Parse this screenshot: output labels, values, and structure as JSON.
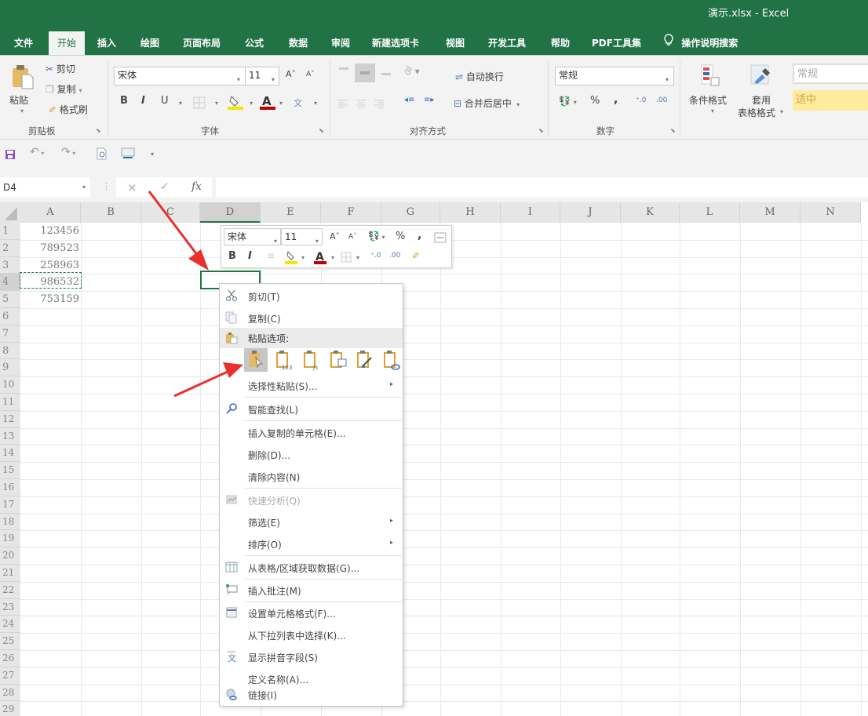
{
  "window": {
    "title": "演示.xlsx  -  Excel"
  },
  "tabs": [
    {
      "label": "文件",
      "active": false
    },
    {
      "label": "开始",
      "active": true
    },
    {
      "label": "插入",
      "active": false
    },
    {
      "label": "绘图",
      "active": false
    },
    {
      "label": "页面布局",
      "active": false
    },
    {
      "label": "公式",
      "active": false
    },
    {
      "label": "数据",
      "active": false
    },
    {
      "label": "审阅",
      "active": false
    },
    {
      "label": "新建选项卡",
      "active": false
    },
    {
      "label": "视图",
      "active": false
    },
    {
      "label": "开发工具",
      "active": false
    },
    {
      "label": "帮助",
      "active": false
    },
    {
      "label": "PDF工具集",
      "active": false
    }
  ],
  "tell_me": {
    "icon": "lightbulb-icon",
    "label": "操作说明搜索"
  },
  "ribbon": {
    "clipboard": {
      "paste_label": "粘贴",
      "cut_label": "剪切",
      "copy_label": "复制",
      "format_painter_label": "格式刷",
      "group_label": "剪贴板"
    },
    "font": {
      "font_name": "宋体",
      "font_size": "11",
      "bold": "B",
      "italic": "I",
      "underline": "U",
      "group_label": "字体"
    },
    "alignment": {
      "wrap_text_label": "自动换行",
      "merge_center_label": "合并后居中",
      "group_label": "对齐方式"
    },
    "number": {
      "format": "常规",
      "percent": "%",
      "comma": ",",
      "group_label": "数字"
    },
    "styles": {
      "conditional_format_label": "条件格式",
      "format_table_label_1": "套用",
      "format_table_label_2": "表格格式",
      "style_normal": "常规",
      "style_neutral": "适中",
      "neutral_color": "#ffeb9c"
    }
  },
  "qat": {
    "items": [
      "save-icon",
      "undo-icon",
      "redo-icon",
      "print-preview-icon",
      "form-icon",
      "customize-icon"
    ]
  },
  "formula_bar": {
    "name_box": "D4",
    "cancel": "×",
    "enter": "✓",
    "fx": "fx",
    "value": ""
  },
  "sheet": {
    "columns": [
      "A",
      "B",
      "C",
      "D",
      "E",
      "F",
      "G",
      "H",
      "I",
      "J",
      "K",
      "L",
      "M",
      "N"
    ],
    "selected_column": "D",
    "rows": [
      "1",
      "2",
      "3",
      "4",
      "5",
      "6",
      "7",
      "8",
      "9",
      "10",
      "11",
      "12",
      "13",
      "14",
      "15",
      "16",
      "17",
      "18",
      "19",
      "20",
      "21",
      "22",
      "23",
      "24",
      "25",
      "26",
      "27",
      "28",
      "29"
    ],
    "selected_row": "4",
    "column_a_values": [
      "123456",
      "789523",
      "258963",
      "986532",
      "753159"
    ],
    "active_cell": "D4",
    "copied_cell": "A4"
  },
  "mini_toolbar": {
    "font_name": "宋体",
    "font_size": "11",
    "bold": "B",
    "italic": "I",
    "percent": "%",
    "comma": ","
  },
  "context_menu": {
    "items": [
      {
        "label": "剪切(T)",
        "icon": "scissors-icon"
      },
      {
        "label": "复制(C)",
        "icon": "copy-icon"
      },
      {
        "label": "粘贴选项:",
        "icon": "paste-icon",
        "header": true
      },
      {
        "label": "选择性粘贴(S)...",
        "submenu": true
      },
      {
        "label": "智能查找(L)",
        "icon": "search-icon"
      },
      {
        "label": "插入复制的单元格(E)..."
      },
      {
        "label": "删除(D)..."
      },
      {
        "label": "清除内容(N)"
      },
      {
        "label": "快速分析(Q)",
        "icon": "quick-analysis-icon",
        "disabled": true
      },
      {
        "label": "筛选(E)",
        "submenu": true
      },
      {
        "label": "排序(O)",
        "submenu": true
      },
      {
        "label": "从表格/区域获取数据(G)...",
        "icon": "table-icon"
      },
      {
        "label": "插入批注(M)",
        "icon": "comment-icon"
      },
      {
        "label": "设置单元格格式(F)...",
        "icon": "format-cells-icon"
      },
      {
        "label": "从下拉列表中选择(K)..."
      },
      {
        "label": "显示拼音字段(S)",
        "icon": "phonetic-icon"
      },
      {
        "label": "定义名称(A)..."
      },
      {
        "label": "链接(I)",
        "icon": "link-icon"
      }
    ],
    "paste_options": [
      {
        "name": "paste-default",
        "selected": true
      },
      {
        "name": "paste-values",
        "badge": "123"
      },
      {
        "name": "paste-formulas",
        "badge": "fx"
      },
      {
        "name": "paste-formatting"
      },
      {
        "name": "paste-format-painter"
      },
      {
        "name": "paste-link"
      }
    ]
  },
  "annotations": {
    "arrow_color": "#e8312f",
    "count": 2
  }
}
